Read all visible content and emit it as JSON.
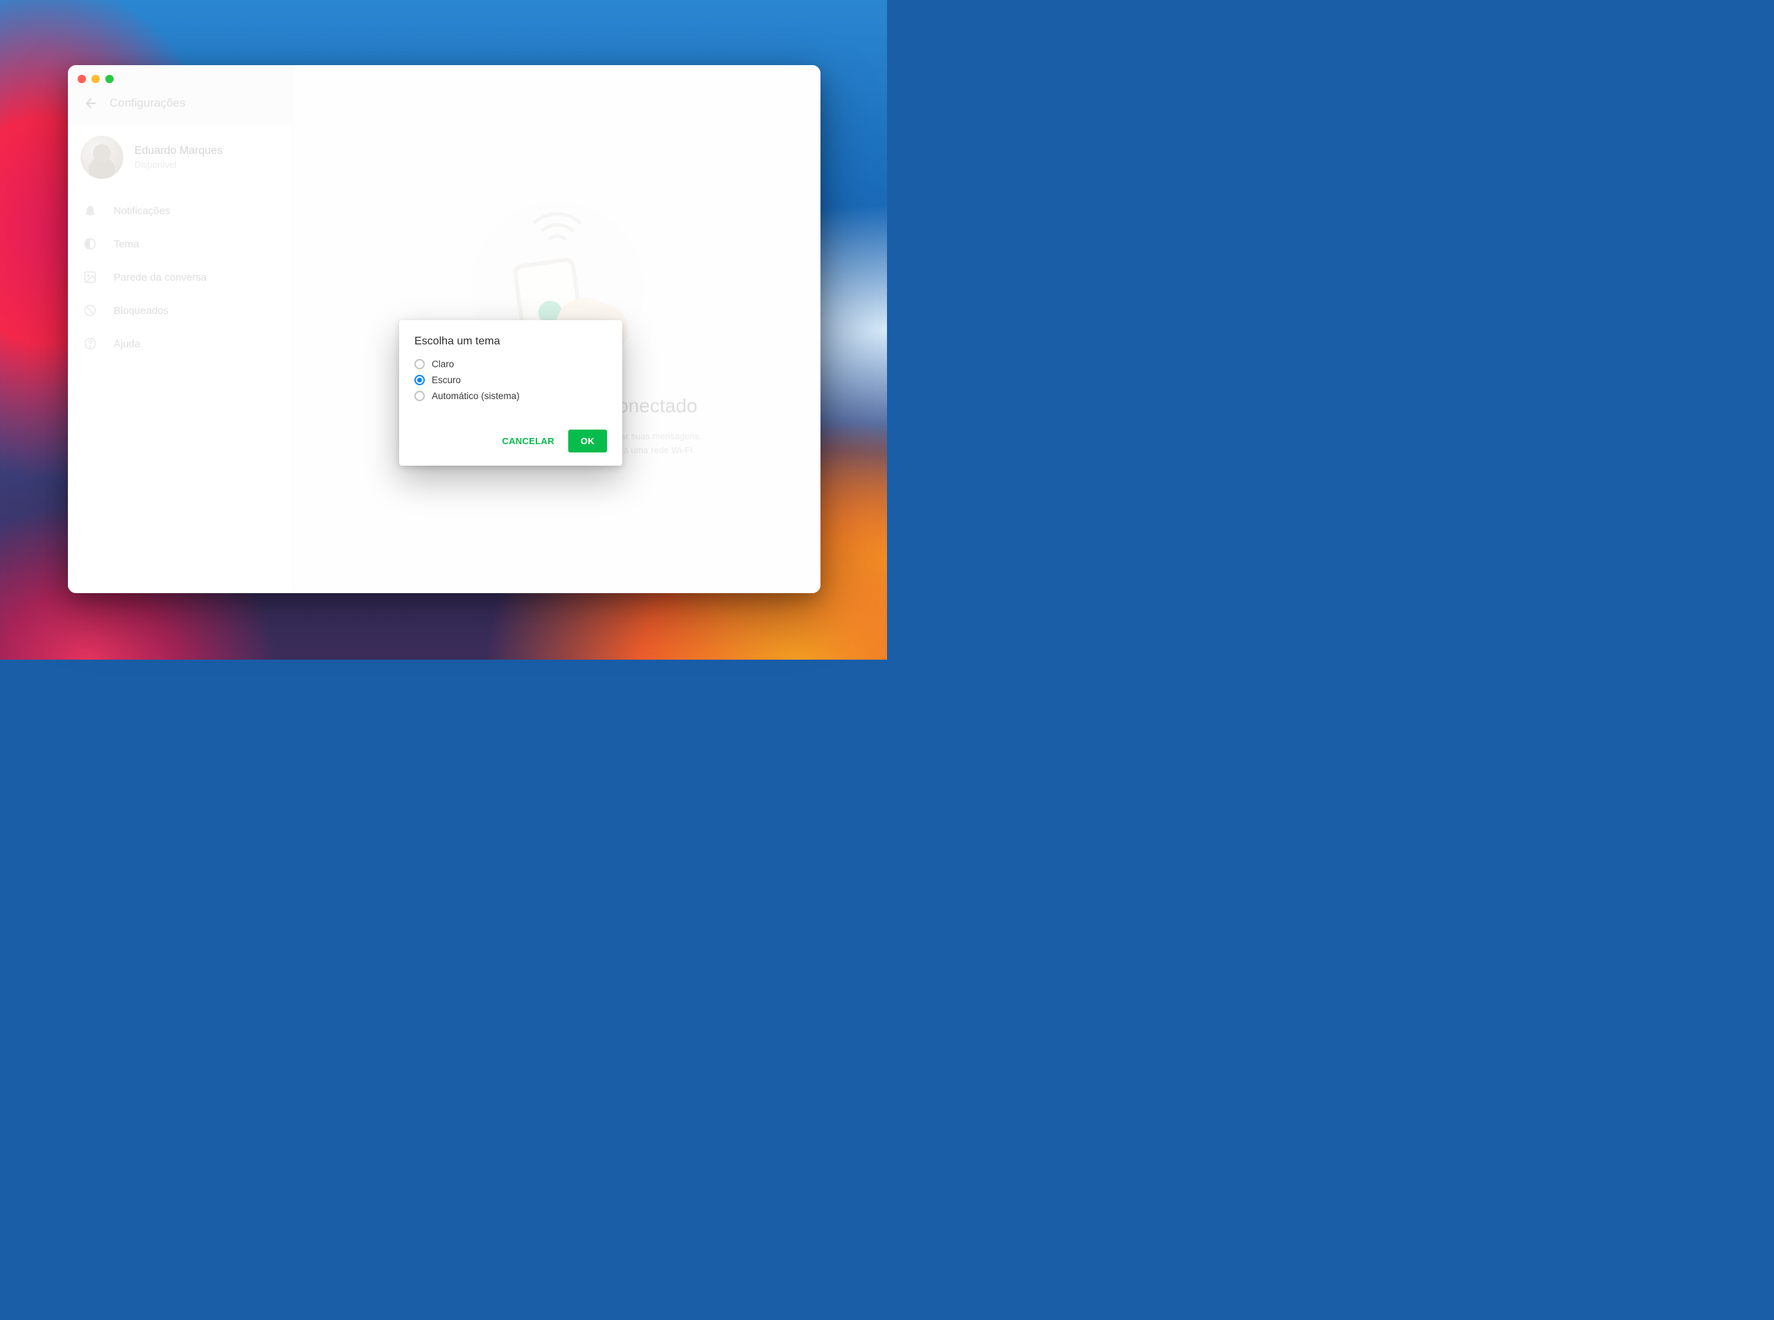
{
  "sidebar": {
    "title": "Configurações",
    "profile": {
      "name": "Eduardo Marques",
      "status": "Disponível"
    },
    "items": [
      {
        "icon": "bell-icon",
        "label": "Notificações"
      },
      {
        "icon": "theme-icon",
        "label": "Tema"
      },
      {
        "icon": "wallpaper-icon",
        "label": "Parede da conversa"
      },
      {
        "icon": "blocked-icon",
        "label": "Bloqueados"
      },
      {
        "icon": "help-icon",
        "label": "Ajuda"
      }
    ]
  },
  "main": {
    "hero_title": "Mantenha seu celular conectado",
    "hero_desc_line1": "O WhatsApp conecta ao seu telefone para sincronizar suas mensagens.",
    "hero_desc_line2": "Para reduzir o uso de dados, conecte seu telefone a uma rede Wi-Fi."
  },
  "modal": {
    "title": "Escolha um tema",
    "options": [
      {
        "label": "Claro",
        "selected": false
      },
      {
        "label": "Escuro",
        "selected": true
      },
      {
        "label": "Automático (sistema)",
        "selected": false
      }
    ],
    "cancel_label": "CANCELAR",
    "ok_label": "OK"
  },
  "colors": {
    "accent_green": "#07bc4c",
    "radio_selected": "#0a84ff"
  }
}
